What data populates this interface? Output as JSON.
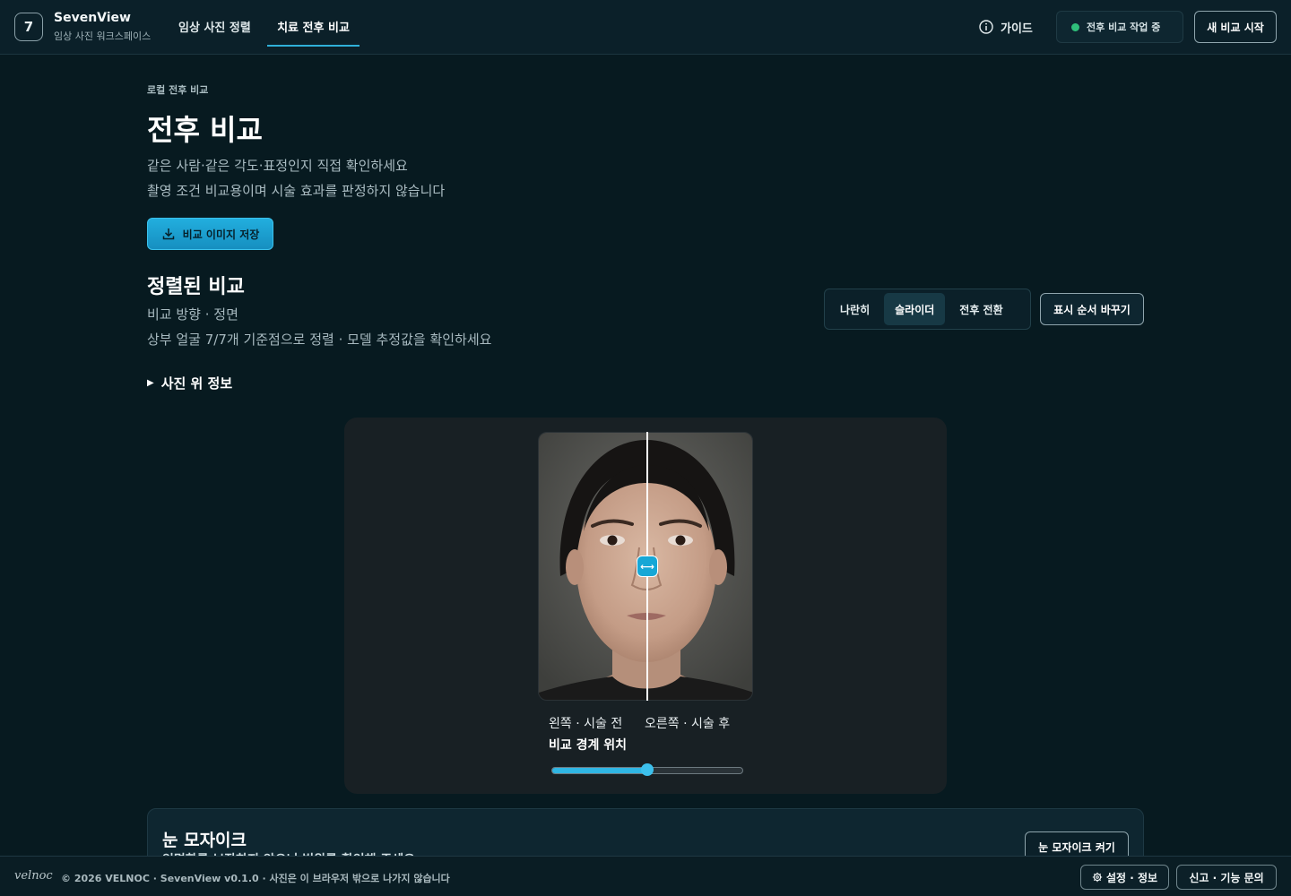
{
  "header": {
    "logo_text": "7",
    "app_name": "SevenView",
    "app_subtitle": "임상 사진 워크스페이스",
    "tabs": [
      {
        "label": "임상 사진 정렬",
        "active": false
      },
      {
        "label": "치료 전후 비교",
        "active": true
      }
    ],
    "guide_label": "가이드",
    "status_label": "전후 비교 작업 중",
    "status_color": "#2fbf7a",
    "new_compare_label": "새 비교 시작"
  },
  "main": {
    "breadcrumb": "로컬 전후 비교",
    "title": "전후 비교",
    "subtitle_lines": [
      "같은 사람·같은 각도·표정인지 직접 확인하세요",
      "촬영 조건 비교용이며 시술 효과를 판정하지 않습니다"
    ],
    "save_label": "비교 이미지 저장",
    "section_title": "정렬된 비교",
    "meta_lines": [
      "비교 방향 · 정면",
      "상부 얼굴 7/7개 기준점으로 정렬 · 모델 추정값을 확인하세요"
    ],
    "view_modes": [
      {
        "label": "나란히",
        "active": false
      },
      {
        "label": "슬라이더",
        "active": true
      },
      {
        "label": "전후 전환",
        "active": false
      }
    ],
    "swap_label": "표시 순서 바꾸기",
    "details_label": "사진 위 정보",
    "accent_color": "#16a7d6"
  },
  "compare": {
    "left_label": "왼쪽 · 시술 전",
    "right_label": "오른쪽 · 시술 후",
    "range_label": "비교 경계 위치",
    "slider_value_percent": 50,
    "handle_icon": "resize-horizontal-icon",
    "handle_glyph": "⟷"
  },
  "mosaic": {
    "title": "눈 모자이크",
    "description": "익명화를 보장하지 않으니 범위를 확인해 주세요",
    "toggle_label": "눈 모자이크 켜기"
  },
  "footer": {
    "brand": "velnoc",
    "copyright": "© 2026 VELNOC · SevenView v0.1.0 · 사진은 이 브라우저 밖으로 나가지 않습니다",
    "settings_label": "설정 · 정보",
    "report_label": "신고 · 기능 문의"
  }
}
